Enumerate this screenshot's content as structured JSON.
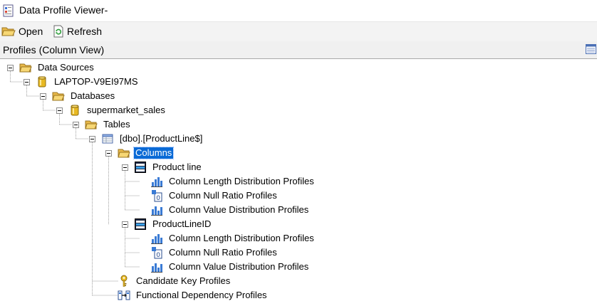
{
  "window": {
    "title": "Data Profile Viewer-"
  },
  "toolbar": {
    "open_label": "Open",
    "refresh_label": "Refresh"
  },
  "panel": {
    "title": "Profiles (Column View)"
  },
  "tree": {
    "data_sources": "Data Sources",
    "server": "LAPTOP-V9EI97MS",
    "databases": "Databases",
    "database": "supermarket_sales",
    "tables": "Tables",
    "table": "[dbo].[ProductLine$]",
    "columns": "Columns",
    "col1": {
      "name": "Product line",
      "profiles": [
        "Column Length Distribution Profiles",
        "Column Null Ratio Profiles",
        "Column Value Distribution Profiles"
      ]
    },
    "col2": {
      "name": "ProductLineID",
      "profiles": [
        "Column Length Distribution Profiles",
        "Column Null Ratio Profiles",
        "Column Value Distribution Profiles"
      ]
    },
    "candidate_key": "Candidate Key Profiles",
    "functional_dependency": "Functional Dependency Profiles"
  },
  "colors": {
    "selection": "#0a6ad6",
    "folder": "#f2c94c",
    "database": "#e8b923"
  }
}
